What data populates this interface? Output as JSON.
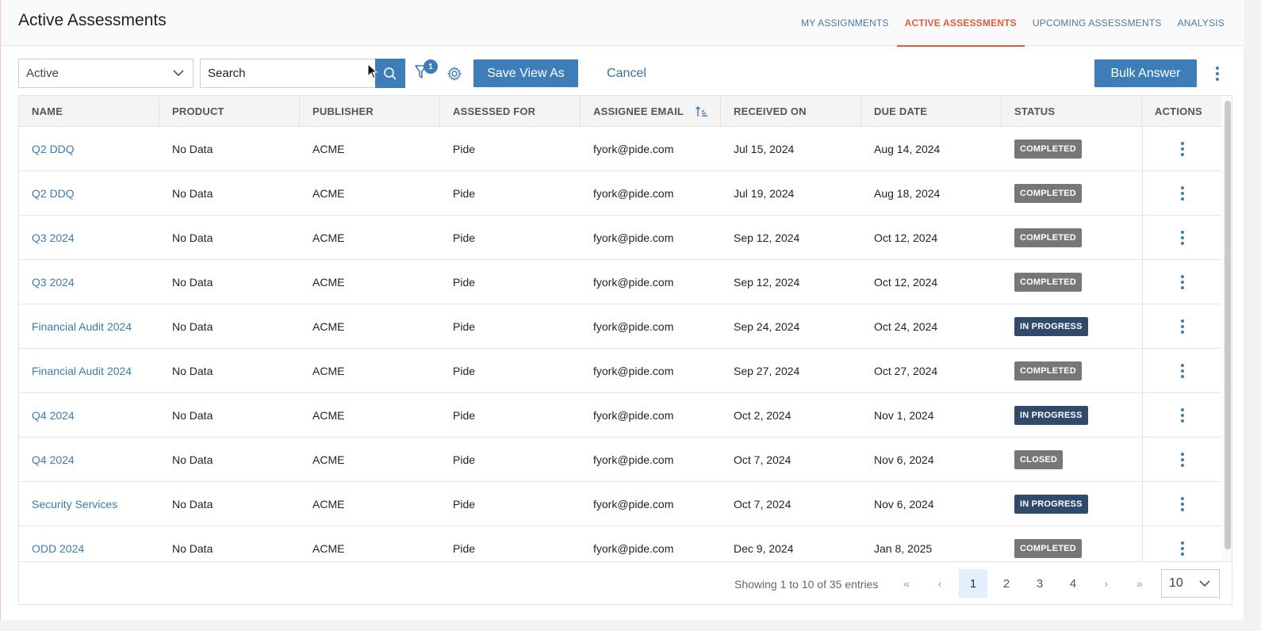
{
  "header": {
    "title": "Active Assessments",
    "tabs": [
      {
        "label": "MY ASSIGNMENTS",
        "active": false
      },
      {
        "label": "ACTIVE ASSESSMENTS",
        "active": true
      },
      {
        "label": "UPCOMING ASSESSMENTS",
        "active": false
      },
      {
        "label": "ANALYSIS",
        "active": false
      }
    ]
  },
  "toolbar": {
    "status_select": "Active",
    "search_placeholder": "Search",
    "filter_count": "1",
    "save_view_label": "Save View As",
    "cancel_label": "Cancel",
    "bulk_answer_label": "Bulk Answer"
  },
  "table": {
    "columns": [
      "NAME",
      "PRODUCT",
      "PUBLISHER",
      "ASSESSED FOR",
      "ASSIGNEE EMAIL",
      "RECEIVED ON",
      "DUE DATE",
      "STATUS",
      "ACTIONS"
    ],
    "rows": [
      {
        "name": "Q2 DDQ",
        "product": "No Data",
        "publisher": "ACME",
        "assessed_for": "Pide",
        "email": "fyork@pide.com",
        "received": "Jul 15, 2024",
        "due": "Aug 14, 2024",
        "status": "COMPLETED"
      },
      {
        "name": "Q2 DDQ",
        "product": "No Data",
        "publisher": "ACME",
        "assessed_for": "Pide",
        "email": "fyork@pide.com",
        "received": "Jul 19, 2024",
        "due": "Aug 18, 2024",
        "status": "COMPLETED"
      },
      {
        "name": "Q3 2024",
        "product": "No Data",
        "publisher": "ACME",
        "assessed_for": "Pide",
        "email": "fyork@pide.com",
        "received": "Sep 12, 2024",
        "due": "Oct 12, 2024",
        "status": "COMPLETED"
      },
      {
        "name": "Q3 2024",
        "product": "No Data",
        "publisher": "ACME",
        "assessed_for": "Pide",
        "email": "fyork@pide.com",
        "received": "Sep 12, 2024",
        "due": "Oct 12, 2024",
        "status": "COMPLETED"
      },
      {
        "name": "Financial Audit 2024",
        "product": "No Data",
        "publisher": "ACME",
        "assessed_for": "Pide",
        "email": "fyork@pide.com",
        "received": "Sep 24, 2024",
        "due": "Oct 24, 2024",
        "status": "IN PROGRESS"
      },
      {
        "name": "Financial Audit 2024",
        "product": "No Data",
        "publisher": "ACME",
        "assessed_for": "Pide",
        "email": "fyork@pide.com",
        "received": "Sep 27, 2024",
        "due": "Oct 27, 2024",
        "status": "COMPLETED"
      },
      {
        "name": "Q4 2024",
        "product": "No Data",
        "publisher": "ACME",
        "assessed_for": "Pide",
        "email": "fyork@pide.com",
        "received": "Oct 2, 2024",
        "due": "Nov 1, 2024",
        "status": "IN PROGRESS"
      },
      {
        "name": "Q4 2024",
        "product": "No Data",
        "publisher": "ACME",
        "assessed_for": "Pide",
        "email": "fyork@pide.com",
        "received": "Oct 7, 2024",
        "due": "Nov 6, 2024",
        "status": "CLOSED"
      },
      {
        "name": "Security Services",
        "product": "No Data",
        "publisher": "ACME",
        "assessed_for": "Pide",
        "email": "fyork@pide.com",
        "received": "Oct 7, 2024",
        "due": "Nov 6, 2024",
        "status": "IN PROGRESS"
      },
      {
        "name": "ODD 2024",
        "product": "No Data",
        "publisher": "ACME",
        "assessed_for": "Pide",
        "email": "fyork@pide.com",
        "received": "Dec 9, 2024",
        "due": "Jan 8, 2025",
        "status": "COMPLETED"
      }
    ]
  },
  "pagination": {
    "showing_text": "Showing 1 to 10 of 35 entries",
    "pages": [
      "1",
      "2",
      "3",
      "4"
    ],
    "current_page": "1",
    "page_size": "10"
  },
  "colors": {
    "accent": "#3d7eb9",
    "tab_active": "#e25b3a",
    "link": "#3e7aae",
    "status_completed": "#777777",
    "status_in_progress": "#2f4a6b",
    "status_closed": "#777777"
  },
  "icons": {
    "search_button": "search-icon",
    "filter_button": "filter-icon",
    "settings_button": "gear-icon",
    "more_menu": "vertical-dots-icon",
    "sort_indicator": "sort-ascending-icon",
    "dropdown": "chevron-down-icon"
  }
}
